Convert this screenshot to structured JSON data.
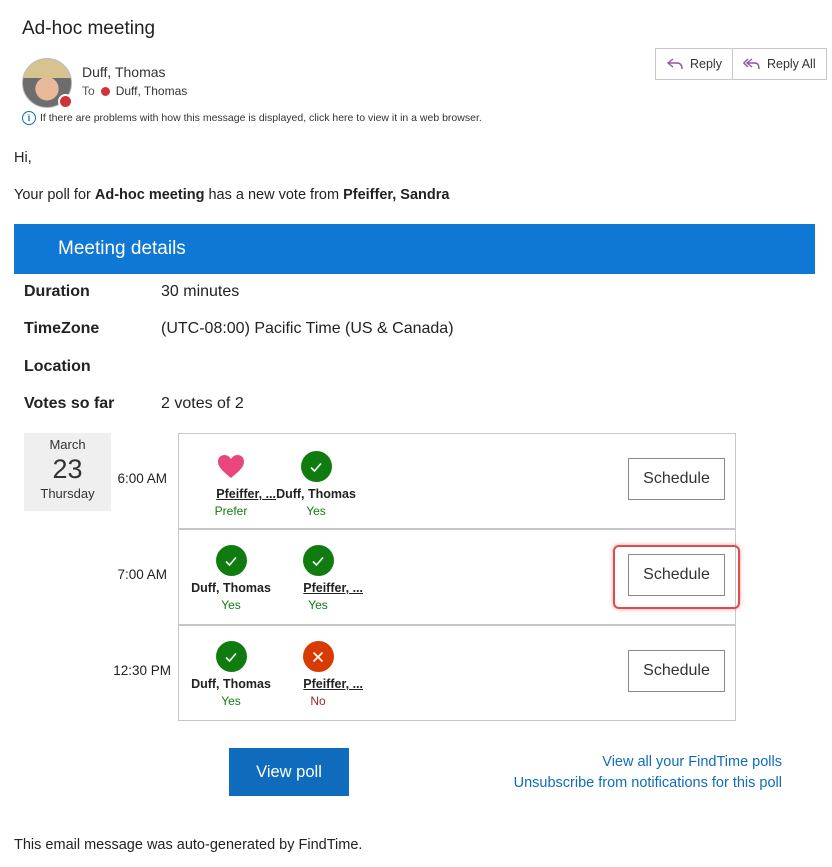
{
  "email": {
    "subject": "Ad-hoc meeting",
    "sender": "Duff, Thomas",
    "to_label": "To",
    "recipient": "Duff, Thomas",
    "info_notice": "If there are problems with how this message is displayed, click here to view it in a web browser.",
    "reply_label": "Reply",
    "reply_all_label": "Reply All"
  },
  "body": {
    "greeting": "Hi,",
    "intro_prefix": "Your poll for ",
    "poll_name": "Ad-hoc meeting",
    "intro_mid": " has a new vote from ",
    "voter": "Pfeiffer, Sandra"
  },
  "details": {
    "banner_title": "Meeting details",
    "duration_label": "Duration",
    "duration_value": "30 minutes",
    "timezone_label": "TimeZone",
    "timezone_value": "(UTC-08:00) Pacific Time (US & Canada)",
    "location_label": "Location",
    "location_value": "",
    "votes_label": "Votes so far",
    "votes_value": "2 votes of 2"
  },
  "date": {
    "month": "March",
    "day": "23",
    "weekday": "Thursday"
  },
  "slots": [
    {
      "time": "6:00 AM",
      "schedule_label": "Schedule",
      "votes": [
        {
          "name": "Pfeiffer, ...",
          "response": "Prefer",
          "icon": "heart-icon"
        },
        {
          "name": "Duff, Thomas",
          "response": "Yes",
          "icon": "check-icon"
        }
      ]
    },
    {
      "time": "7:00 AM",
      "schedule_label": "Schedule",
      "votes": [
        {
          "name": "Duff, Thomas",
          "response": "Yes",
          "icon": "check-icon"
        },
        {
          "name": "Pfeiffer, ...",
          "response": "Yes",
          "icon": "check-icon"
        }
      ]
    },
    {
      "time": "12:30 PM",
      "schedule_label": "Schedule",
      "votes": [
        {
          "name": "Duff, Thomas",
          "response": "Yes",
          "icon": "check-icon"
        },
        {
          "name": "Pfeiffer, ...",
          "response": "No",
          "icon": "x-icon"
        }
      ]
    }
  ],
  "actions": {
    "view_poll": "View poll",
    "view_all": "View all your FindTime polls",
    "unsubscribe": "Unsubscribe from notifications for this poll"
  },
  "footer": "This email message was auto-generated by FindTime.",
  "colors": {
    "brand": "#0f78d4",
    "yes": "#107c10",
    "no": "#d83b01",
    "prefer": "#e8467c",
    "highlight": "#e04a4a"
  }
}
